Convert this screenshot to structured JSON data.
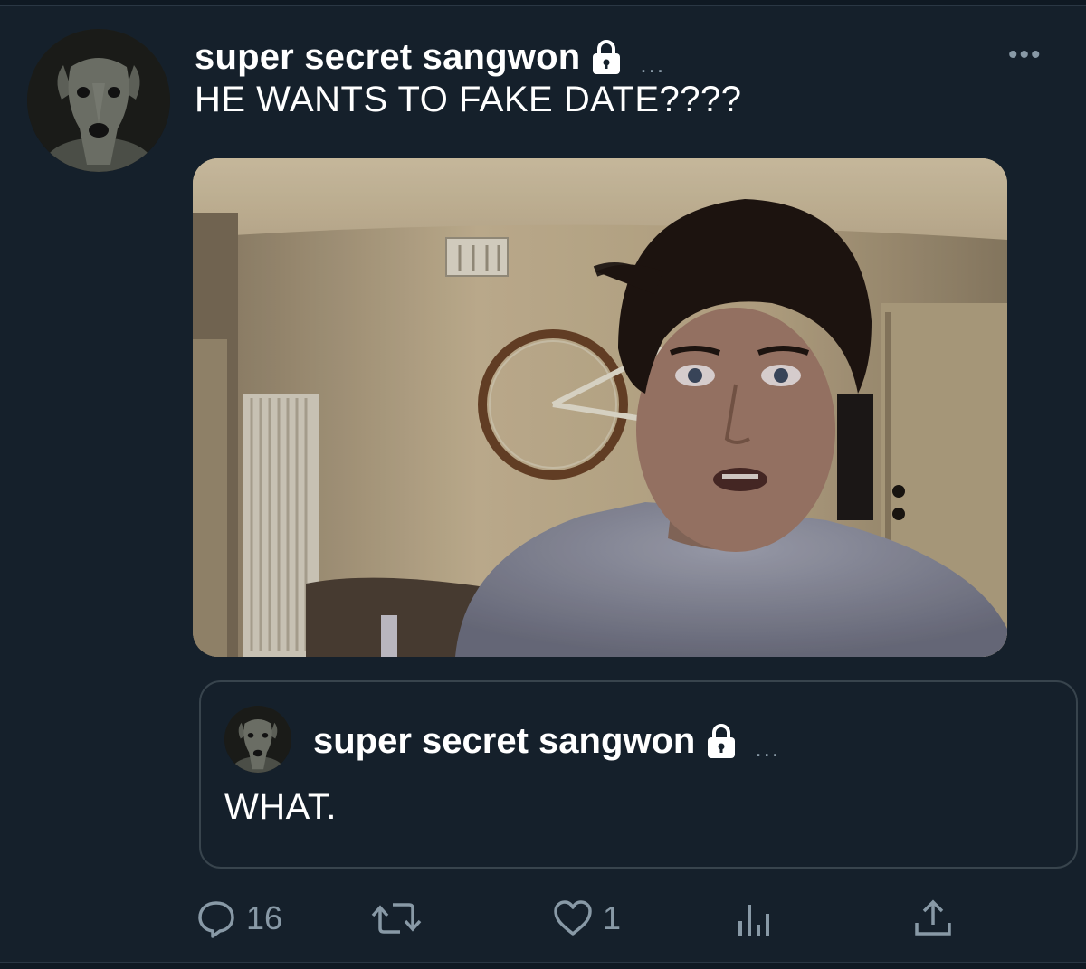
{
  "tweet": {
    "author_name": "super secret sangwon",
    "text": "HE WANTS TO FAKE DATE????",
    "more_label": "•••",
    "inline_dots": "...",
    "media_alt": "webcam photo of a startled man in a room with a bicycle on the wall"
  },
  "quote": {
    "author_name": "super secret sangwon",
    "inline_dots": "...",
    "text": "WHAT."
  },
  "actions": {
    "reply_count": "16",
    "retweet_count": "",
    "like_count": "1"
  },
  "icons": {
    "lock": "lock-icon",
    "reply": "reply-icon",
    "retweet": "retweet-icon",
    "like": "heart-icon",
    "analytics": "analytics-icon",
    "share": "share-icon",
    "more": "more-icon"
  },
  "colors": {
    "background": "#15202b",
    "text": "#ffffff",
    "muted": "#8899a6",
    "border": "#38444d"
  }
}
